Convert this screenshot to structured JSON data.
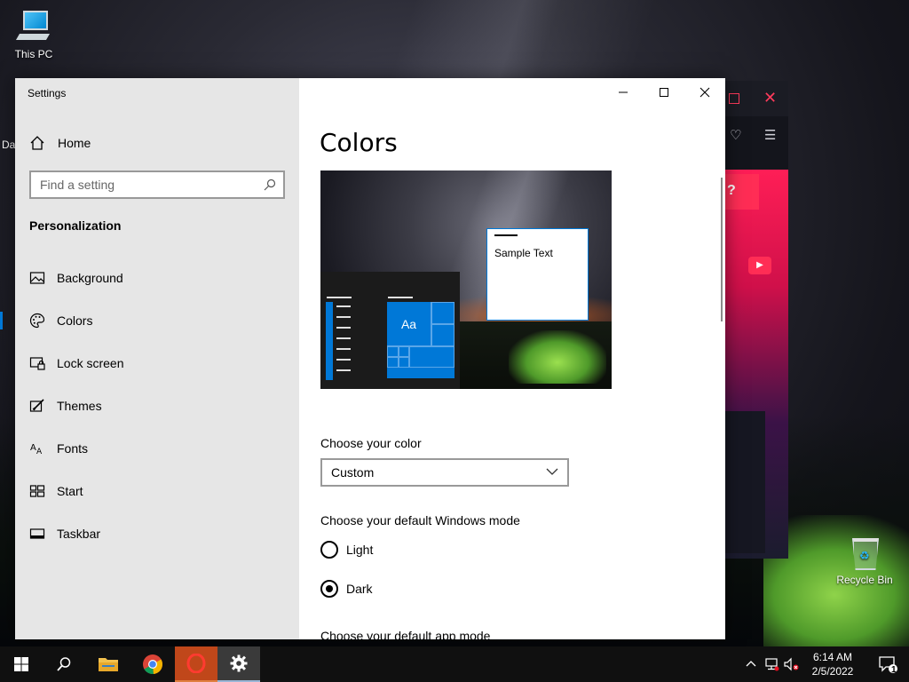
{
  "desktop": {
    "this_pc_label": "This PC",
    "recycle_bin_label": "Recycle Bin",
    "edge_label": "Da"
  },
  "settings_window": {
    "title": "Settings",
    "home_label": "Home",
    "search": {
      "placeholder": "Find a setting"
    },
    "section_title": "Personalization",
    "nav_items": [
      {
        "label": "Background",
        "icon": "picture-icon"
      },
      {
        "label": "Colors",
        "icon": "palette-icon"
      },
      {
        "label": "Lock screen",
        "icon": "lock-screen-icon"
      },
      {
        "label": "Themes",
        "icon": "themes-icon"
      },
      {
        "label": "Fonts",
        "icon": "fonts-icon"
      },
      {
        "label": "Start",
        "icon": "start-icon"
      },
      {
        "label": "Taskbar",
        "icon": "taskbar-icon"
      }
    ],
    "selected_nav": "Colors",
    "page_title": "Colors",
    "preview": {
      "tile_label": "Aa",
      "sample_text": "Sample Text"
    },
    "choose_color_label": "Choose your color",
    "color_dropdown_value": "Custom",
    "windows_mode_label": "Choose your default Windows mode",
    "windows_mode_options": [
      {
        "label": "Light",
        "selected": false
      },
      {
        "label": "Dark",
        "selected": true
      }
    ],
    "app_mode_label": "Choose your default app mode",
    "accent_color": "#0078d7"
  },
  "taskbar": {
    "clock_time": "6:14 AM",
    "clock_date": "2/5/2022",
    "notification_count": "1",
    "apps": [
      "start-icon",
      "search-icon",
      "file-explorer-icon",
      "chrome-icon",
      "opera-icon",
      "settings-icon"
    ]
  }
}
